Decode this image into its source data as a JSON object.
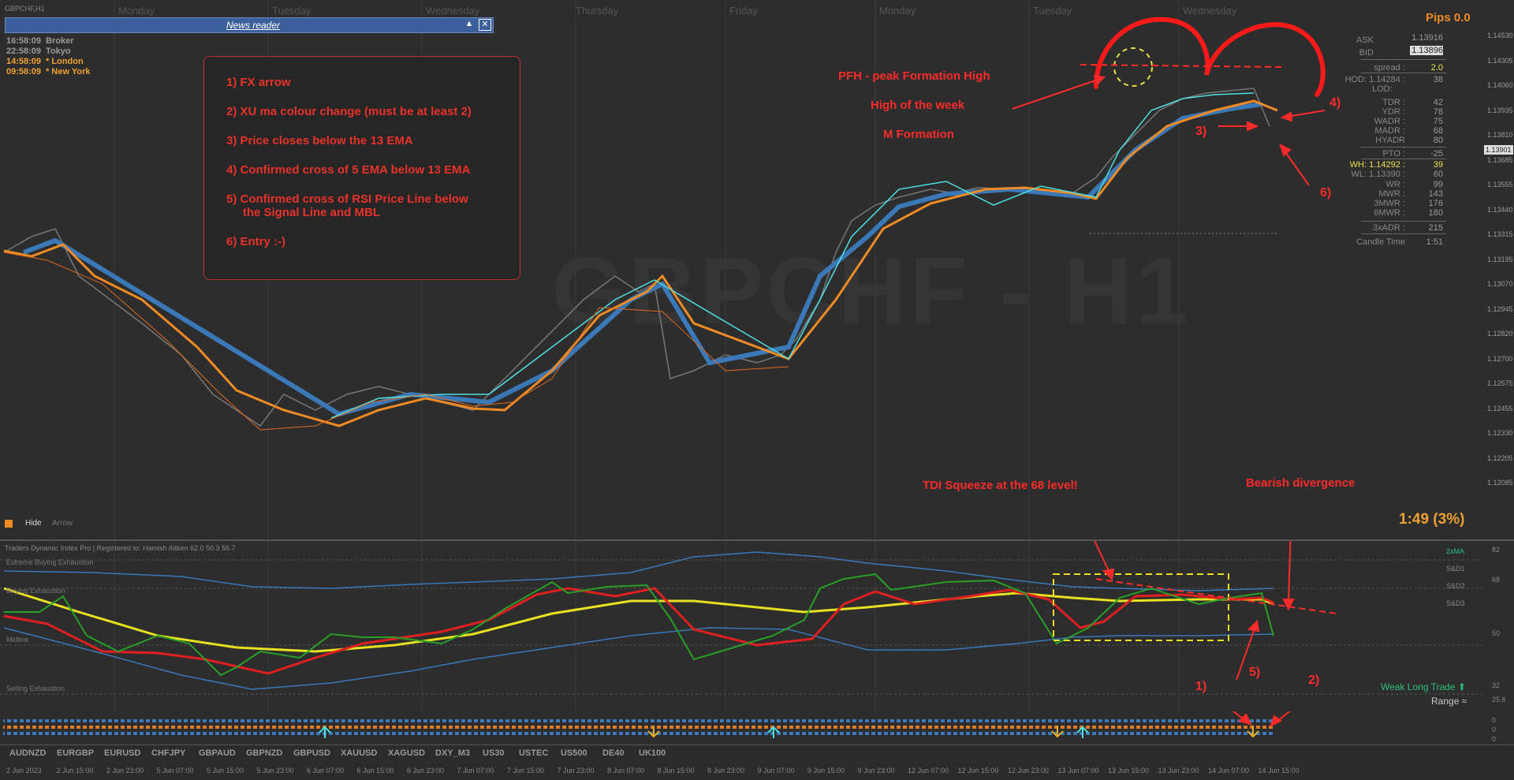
{
  "chart": {
    "title": "GBPCHF,H1",
    "watermark": "GBPCHF - H1",
    "pips": "Pips 0.0",
    "countdown": "1:49 (3%)",
    "days": [
      "Monday",
      "Tuesday",
      "Wednesday",
      "Thursday",
      "Friday",
      "Monday",
      "Tuesday",
      "Wednesday"
    ]
  },
  "clocks": [
    {
      "time": "16:58:09",
      "label": "Broker",
      "color": "#9a9a9a"
    },
    {
      "time": "22:58:09",
      "label": "Tokyo",
      "color": "#9a9a9a"
    },
    {
      "time": "14:58:09",
      "label": "* London",
      "color": "#f0a030"
    },
    {
      "time": "09:58:09",
      "label": "* New York",
      "color": "#f0a030"
    }
  ],
  "news_reader": {
    "title": "News reader",
    "up": "▲",
    "close": "✕"
  },
  "rules": [
    "1) FX arrow",
    "2) XU ma colour change (must be at least 2)",
    "3) Price closes below the 13 EMA",
    "4) Confirmed cross of 5 EMA below 13 EMA",
    "5) Confirmed cross of RSI Price Line below\n     the Signal Line and MBL",
    "6) Entry :-)"
  ],
  "annotations": {
    "pfh": "PFH - peak Formation High",
    "how": "High of the week",
    "m_form": "M Formation",
    "tdi_squeeze": "TDI Squeeze at the 68 level!",
    "bear_div": "Bearish divergence",
    "n3": "3)",
    "n4": "4)",
    "n6": "6)",
    "n1": "1)",
    "n2": "2)",
    "n5": "5)"
  },
  "stats": {
    "ask_label": "ASK",
    "ask": "1.13916",
    "bid_label": "BID",
    "bid": "1.13896",
    "spread_label": "spread :",
    "spread": "2.0",
    "hod_label": "HOD: 1.14284 :",
    "hod": "38",
    "lod_label": "LOD:",
    "lod": "",
    "rows": [
      {
        "label": "TDR :",
        "value": "42"
      },
      {
        "label": "YDR :",
        "value": "78"
      },
      {
        "label": "WADR :",
        "value": "75"
      },
      {
        "label": "MADR :",
        "value": "68"
      },
      {
        "label": "HYADR :",
        "value": "80"
      }
    ],
    "pto_label": "PTO :",
    "pto": "-25",
    "wh_label": "WH: 1.14292 :",
    "wh": "39",
    "wl_label": "WL: 1.13390 :",
    "wl": "60",
    "rows2": [
      {
        "label": "WR :",
        "value": "99"
      },
      {
        "label": "MWR :",
        "value": "143"
      },
      {
        "label": "3MWR :",
        "value": "176"
      },
      {
        "label": "6MWR :",
        "value": "180"
      }
    ],
    "adr3_label": "3xADR :",
    "adr3": "215",
    "candle_label": "Candle Time",
    "candle": "1:51"
  },
  "price_ticks": [
    "1.14530",
    "1.14305",
    "1.14060",
    "1.13935",
    "1.13810",
    "1.13685",
    "1.13555",
    "1.13440",
    "1.13315",
    "1.13195",
    "1.13070",
    "1.12945",
    "1.12820",
    "1.12700",
    "1.12575",
    "1.12455",
    "1.12330",
    "1.12205",
    "1.12085"
  ],
  "current_price": "1.13901",
  "hide_panel": {
    "hide": "Hide",
    "arrow": "Arrow"
  },
  "indicator": {
    "title": "Traders Dynamic Index Pro | Registered to: Hamish Aitken 62.0 50.3 56.7",
    "levels": [
      "Extreme Buying Exhaustion",
      "Buying Exhaustion",
      "Midline",
      "Selling Exhaustion"
    ],
    "right_labels": [
      "2xMA",
      "S&D1",
      "S&D2",
      "S&D3"
    ],
    "ticks": [
      "82",
      "68",
      "50",
      "32",
      "25.6"
    ],
    "signal": "Weak Long Trade ⬆",
    "range": "Range ≈"
  },
  "bar_pane_ticks": [
    "0",
    "0",
    "0"
  ],
  "symbols": [
    "AUDNZD",
    "EURGBP",
    "EURUSD",
    "CHFJPY",
    "GBPAUD",
    "GBPNZD",
    "GBPUSD",
    "XAUUSD",
    "XAGUSD",
    "DXY_M3",
    "US30",
    "USTEC",
    "US500",
    "DE40",
    "UK100"
  ],
  "time_ticks": [
    "2 Jun 2023",
    "2 Jun 15:00",
    "2 Jun 23:00",
    "5 Jun 07:00",
    "5 Jun 15:00",
    "5 Jun 23:00",
    "6 Jun 07:00",
    "6 Jun 15:00",
    "6 Jun 23:00",
    "7 Jun 07:00",
    "7 Jun 15:00",
    "7 Jun 23:00",
    "8 Jun 07:00",
    "8 Jun 15:00",
    "8 Jun 23:00",
    "9 Jun 07:00",
    "9 Jun 15:00",
    "9 Jun 23:00",
    "12 Jun 07:00",
    "12 Jun 15:00",
    "12 Jun 23:00",
    "13 Jun 07:00",
    "13 Jun 15:00",
    "13 Jun 23:00",
    "14 Jun 07:00",
    "14 Jun 15:00"
  ]
}
